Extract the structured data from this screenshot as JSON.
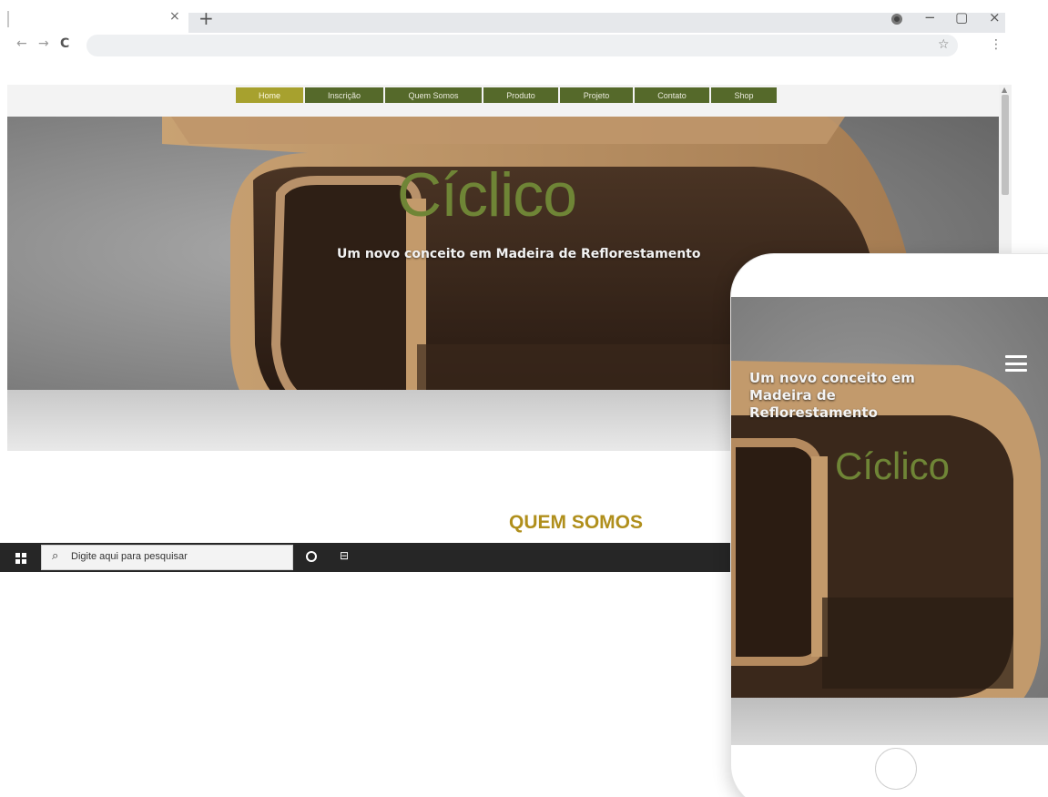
{
  "browser": {
    "tab_close": "×",
    "new_tab": "+",
    "nav": {
      "back": "←",
      "forward": "→",
      "reload": "C"
    },
    "star": "☆",
    "menu": "⋮",
    "window_controls": {
      "minimize": "−",
      "maximize": "▢",
      "close": "×"
    },
    "icons": [
      "back-arrow-icon",
      "forward-arrow-icon",
      "reload-icon",
      "star-icon",
      "kebab-menu-icon",
      "profile-icon"
    ]
  },
  "site": {
    "nav": [
      {
        "label": "Home",
        "active": true
      },
      {
        "label": "Inscrição",
        "active": false
      },
      {
        "label": "Quem Somos",
        "active": false
      },
      {
        "label": "Produto",
        "active": false
      },
      {
        "label": "Projeto",
        "active": false
      },
      {
        "label": "Contato",
        "active": false
      },
      {
        "label": "Shop",
        "active": false
      }
    ],
    "brand": "Cíclico",
    "tagline": "Um novo conceito em Madeira de Reflorestamento",
    "section_title": "QUEM SOMOS",
    "colors": {
      "brand_green": "#6f8536",
      "nav_green": "#55692a",
      "nav_active": "#a7a12e",
      "section_gold": "#b08f1c"
    }
  },
  "taskbar": {
    "search_placeholder": "Digite aqui para pesquisar",
    "search_icon": "⌕",
    "taskview_icon": "⊟",
    "icons": [
      "windows-logo-icon",
      "search-icon",
      "cortana-icon",
      "task-view-icon"
    ]
  },
  "phone": {
    "tagline": "Um novo conceito em Madeira de Reflorestamento",
    "brand": "Cíclico",
    "icons": [
      "hamburger-menu-icon",
      "home-button"
    ]
  }
}
